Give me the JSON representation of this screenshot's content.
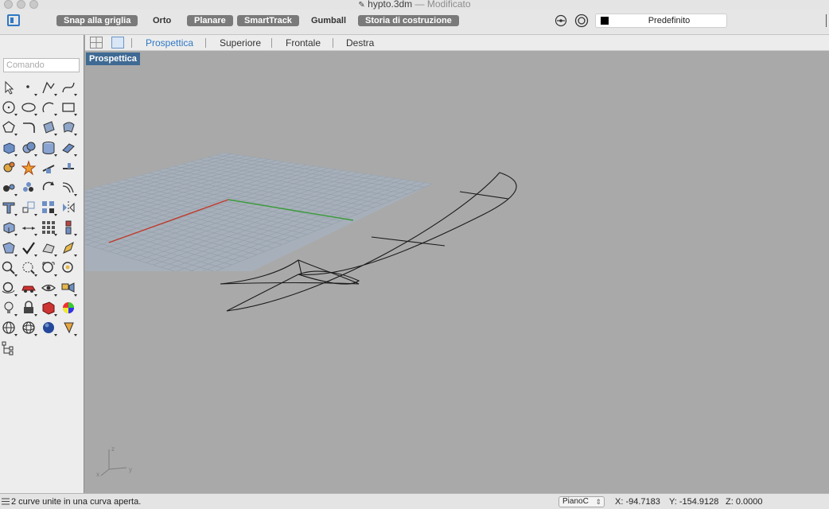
{
  "window": {
    "title": "hypto.3dm",
    "separator": "—",
    "subtitle": "Modificato"
  },
  "toolbar": {
    "snap_grid": "Snap alla griglia",
    "ortho": "Orto",
    "planar": "Planare",
    "smarttrack": "SmartTrack",
    "gumball": "Gumball",
    "history": "Storia di costruzione",
    "layer_name": "Predefinito",
    "layer_color": "#000000"
  },
  "viewport_tabs": [
    "Prospettica",
    "Superiore",
    "Frontale",
    "Destra"
  ],
  "active_tab": "Prospettica",
  "command": {
    "placeholder": "Comando",
    "value": ""
  },
  "viewport": {
    "label": "Prospettica",
    "axis_x_color": "#c0392b",
    "axis_y_color": "#3a9a3a",
    "triad_labels": {
      "x": "x",
      "y": "y",
      "z": "z"
    }
  },
  "tools": [
    [
      "arrow-select-icon",
      "point-icon",
      "polyline-icon",
      "curve-icon"
    ],
    [
      "circle-icon",
      "ellipse-icon",
      "arc-icon",
      "rectangle-icon"
    ],
    [
      "polygon-icon",
      "fillet-curve-icon",
      "surface-corner-icon",
      "surface-edge-icon"
    ],
    [
      "box-solid-icon",
      "boolean-union-icon",
      "cylinder-icon",
      "extrude-surface-icon"
    ],
    [
      "gear-transform-icon",
      "explode-icon",
      "trim-icon",
      "split-icon"
    ],
    [
      "join-icon",
      "group-icon",
      "rotate-icon",
      "offset-icon"
    ],
    [
      "text-icon",
      "scale-icon",
      "array-icon",
      "mirror-icon"
    ],
    [
      "mesh-box-icon",
      "dimension-icon",
      "grid-array-icon",
      "align-icon"
    ],
    [
      "analyze-icon",
      "check-icon",
      "zoom-icon",
      "pencil-icon"
    ],
    [
      "zoom-window-icon",
      "zoom-extents-icon",
      "zoom-selected-icon",
      "zoom-target-icon"
    ],
    [
      "rotate-view-icon",
      "car-render-icon",
      "eye-icon",
      "named-views-icon"
    ],
    [
      "lightbulb-icon",
      "lock-icon",
      "material-icon",
      "color-wheel-icon"
    ],
    [
      "sphere-wire-icon",
      "sphere-grid-icon",
      "sphere-shaded-icon",
      "cone-flag-icon"
    ],
    [
      "tree-diagram-icon"
    ]
  ],
  "status": {
    "message": "2 curve unite in una curva aperta.",
    "plane": "PianoC",
    "x": "X: -94.7183",
    "y": "Y: -154.9128",
    "z": "Z: 0.0000"
  }
}
